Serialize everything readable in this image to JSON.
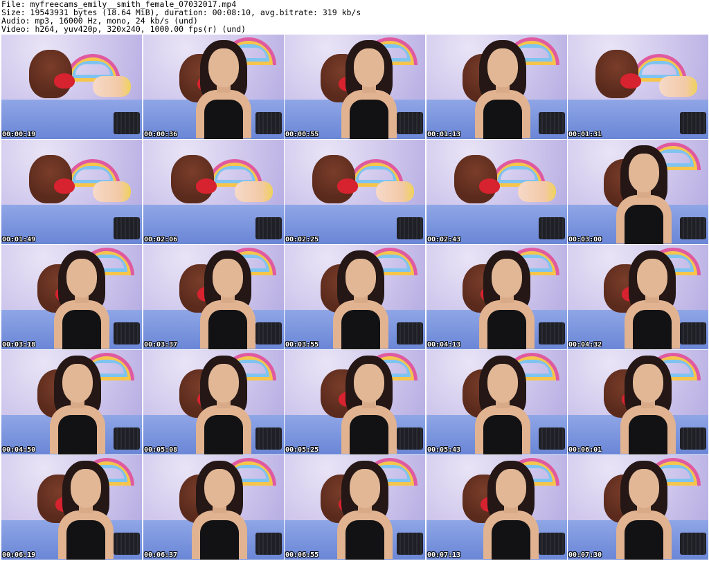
{
  "header": {
    "lines": [
      "File: myfreecams_emily__smith_female_07032017.mp4",
      "Size: 19543931 bytes (18.64 MiB), duration: 00:08:10, avg.bitrate: 319 kb/s",
      "Audio: mp3, 16000 Hz, mono, 24 kb/s (und)",
      "Video: h264, yuv420p, 320x240, 1000.00 fps(r) (und)"
    ]
  },
  "thumbnails": [
    {
      "timestamp": "00:00:19",
      "scene": "room"
    },
    {
      "timestamp": "00:00:36",
      "scene": "person"
    },
    {
      "timestamp": "00:00:55",
      "scene": "person"
    },
    {
      "timestamp": "00:01:13",
      "scene": "person"
    },
    {
      "timestamp": "00:01:31",
      "scene": "room"
    },
    {
      "timestamp": "00:01:49",
      "scene": "room"
    },
    {
      "timestamp": "00:02:06",
      "scene": "room"
    },
    {
      "timestamp": "00:02:25",
      "scene": "room"
    },
    {
      "timestamp": "00:02:43",
      "scene": "room"
    },
    {
      "timestamp": "00:03:00",
      "scene": "person"
    },
    {
      "timestamp": "00:03:18",
      "scene": "person"
    },
    {
      "timestamp": "00:03:37",
      "scene": "person"
    },
    {
      "timestamp": "00:03:55",
      "scene": "person"
    },
    {
      "timestamp": "00:04:13",
      "scene": "person"
    },
    {
      "timestamp": "00:04:32",
      "scene": "person"
    },
    {
      "timestamp": "00:04:50",
      "scene": "person"
    },
    {
      "timestamp": "00:05:08",
      "scene": "person"
    },
    {
      "timestamp": "00:05:25",
      "scene": "person"
    },
    {
      "timestamp": "00:05:43",
      "scene": "person"
    },
    {
      "timestamp": "00:06:01",
      "scene": "person"
    },
    {
      "timestamp": "00:06:19",
      "scene": "person"
    },
    {
      "timestamp": "00:06:37",
      "scene": "person"
    },
    {
      "timestamp": "00:06:55",
      "scene": "person"
    },
    {
      "timestamp": "00:07:13",
      "scene": "person"
    },
    {
      "timestamp": "00:07:30",
      "scene": "person"
    }
  ]
}
